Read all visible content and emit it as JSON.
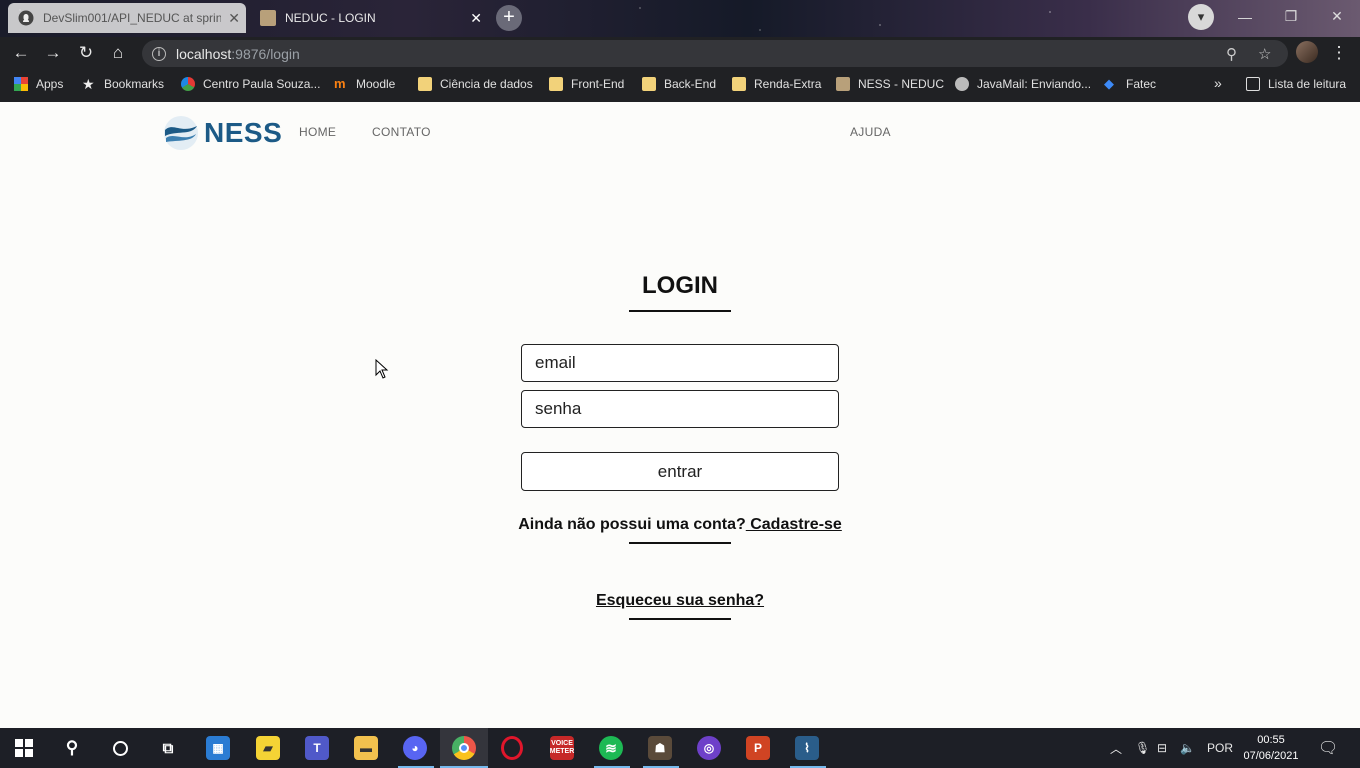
{
  "browser": {
    "tabs": [
      {
        "title": "DevSlim001/API_NEDUC at sprin",
        "icon": "github-icon"
      },
      {
        "title": "NEDUC - LOGIN",
        "icon": "neduc-favicon"
      }
    ],
    "address": {
      "host": "localhost",
      "path": ":9876/login"
    },
    "bookmarks": [
      {
        "label": "Apps",
        "icon": "apps-grid-icon"
      },
      {
        "label": "Bookmarks",
        "icon": "star-icon"
      },
      {
        "label": "Centro Paula Souza...",
        "icon": "cps-icon"
      },
      {
        "label": "Moodle",
        "icon": "moodle-icon"
      },
      {
        "label": "Ciência de dados",
        "icon": "folder-icon"
      },
      {
        "label": "Front-End",
        "icon": "folder-icon"
      },
      {
        "label": "Back-End",
        "icon": "folder-icon"
      },
      {
        "label": "Renda-Extra",
        "icon": "folder-icon"
      },
      {
        "label": "NESS - NEDUC",
        "icon": "neduc-favicon"
      },
      {
        "label": "JavaMail: Enviando...",
        "icon": "site-icon"
      },
      {
        "label": "Fatec",
        "icon": "dropbox-icon"
      }
    ],
    "overflow": "»",
    "reading_list": "Lista de leitura"
  },
  "site": {
    "logo_text": "NESS",
    "nav": {
      "home": "HOME",
      "contato": "CONTATO",
      "ajuda": "AJUDA"
    }
  },
  "login": {
    "title": "LOGIN",
    "email_placeholder": "email",
    "senha_placeholder": "senha",
    "submit_label": "entrar",
    "signup_prompt": "Ainda não possui uma conta?",
    "signup_link": " Cadastre-se",
    "forgot_link": "Esqueceu sua senha?"
  },
  "taskbar": {
    "language": "POR",
    "time": "00:55",
    "date": "07/06/2021",
    "apps": [
      "start",
      "search",
      "cortana",
      "task-view",
      "store",
      "sticky-notes",
      "teams",
      "file-explorer",
      "discord",
      "chrome",
      "opera",
      "voicemeeter",
      "spotify",
      "game",
      "github-desktop",
      "powerpoint",
      "sql-workbench"
    ]
  },
  "colors": {
    "brand": "#1c5a86",
    "page_bg": "#fcfcfa",
    "chrome_bg": "#202124"
  }
}
